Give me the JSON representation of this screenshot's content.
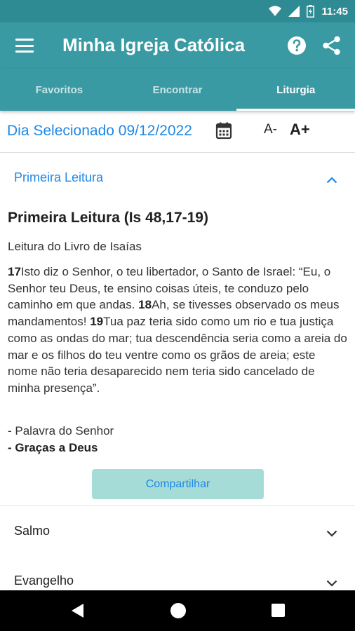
{
  "status_bar": {
    "time": "11:45"
  },
  "app_bar": {
    "title": "Minha Igreja Católica"
  },
  "tabs": [
    {
      "label": "Favoritos"
    },
    {
      "label": "Encontrar"
    },
    {
      "label": "Liturgia"
    }
  ],
  "date_bar": {
    "label": "Dia Selecionado 09/12/2022",
    "font_decrease": "A-",
    "font_increase": "A+"
  },
  "sections": {
    "first": {
      "label": "Primeira Leitura",
      "expanded": true
    },
    "salmo": {
      "label": "Salmo",
      "expanded": false
    },
    "evangelho": {
      "label": "Evangelho",
      "expanded": false
    }
  },
  "reading": {
    "title": "Primeira Leitura (Is 48,17-19)",
    "book": "Leitura do Livro de Isaías",
    "verses": [
      {
        "num": "17",
        "text": "Isto diz o Senhor, o teu libertador, o Santo de Israel: “Eu, o Senhor teu Deus, te ensino coisas úteis, te conduzo pelo caminho em que andas. "
      },
      {
        "num": "18",
        "text": "Ah, se tivesses observado os meus mandamentos! "
      },
      {
        "num": "19",
        "text": "Tua paz teria sido como um rio e tua justiça como as ondas do mar; tua descendência seria como a areia do mar e os filhos do teu ventre como os grãos de areia; este nome não teria desaparecido nem teria sido cancelado de minha presença”."
      }
    ],
    "response_1": "- Palavra do Senhor",
    "response_2": "- Graças a Deus",
    "share_label": "Compartilhar"
  },
  "colors": {
    "primary": "#3a9aa3",
    "status_bar": "#2f8b93",
    "accent": "#1e88e5",
    "share_button_bg": "#a6dcd8"
  }
}
